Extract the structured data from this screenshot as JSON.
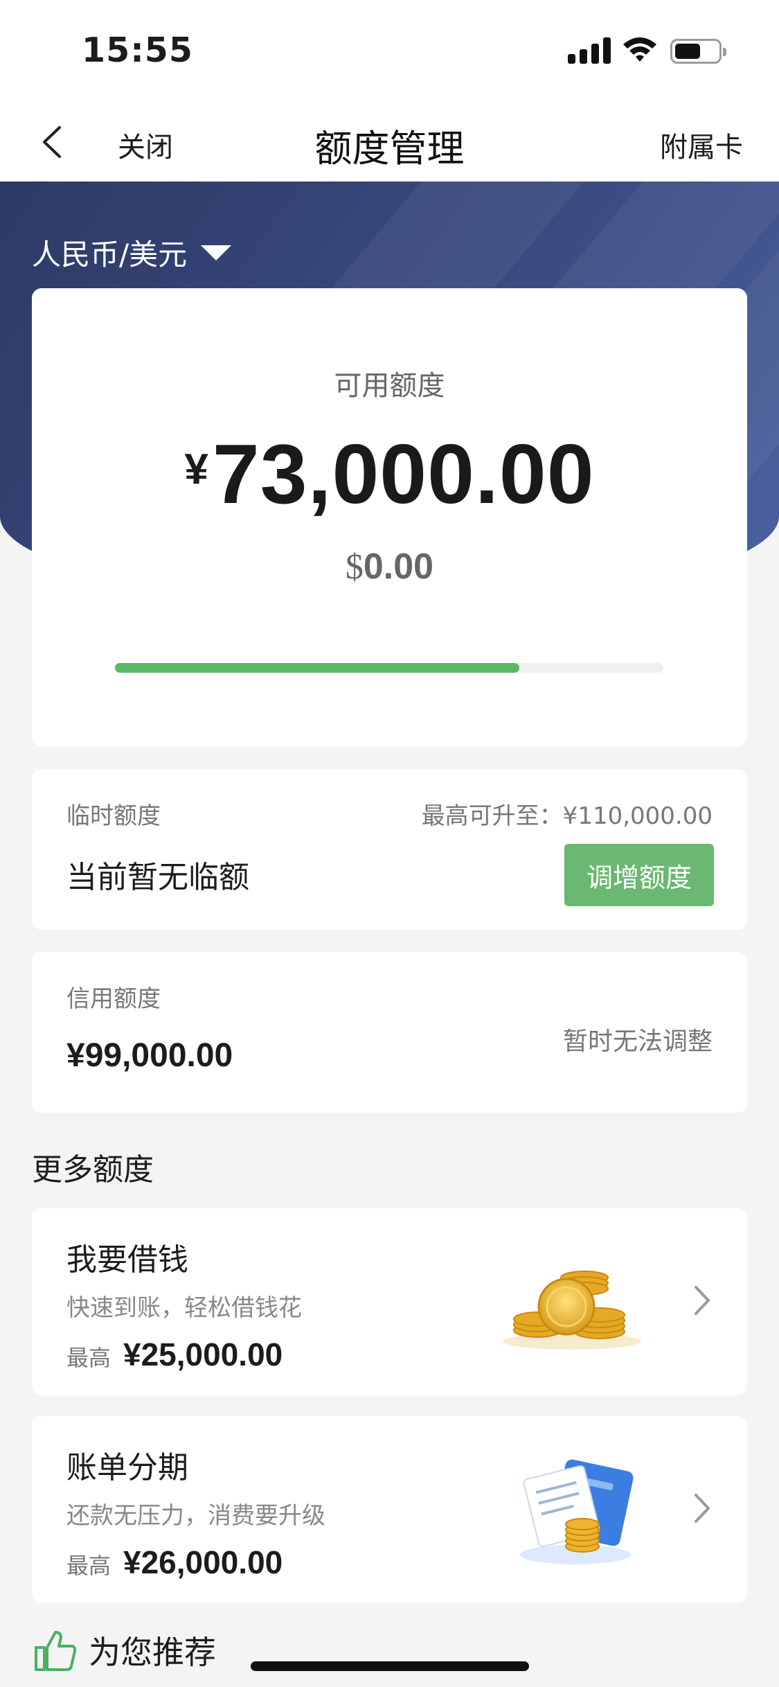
{
  "status_bar": {
    "time": "15:55"
  },
  "nav": {
    "close_label": "关闭",
    "title": "额度管理",
    "right_label": "附属卡"
  },
  "currency_selector": {
    "label": "人民币/美元"
  },
  "available": {
    "label": "可用额度",
    "currency_symbol": "¥",
    "amount": "73,000.00",
    "usd_symbol": "$",
    "usd_amount": "0.00",
    "progress_fraction": 0.737,
    "progress_color": "#5cb867"
  },
  "temporary": {
    "label": "临时额度",
    "max_text": "最高可升至：¥110,000.00",
    "value": "当前暂无临额",
    "button_label": "调增额度"
  },
  "credit": {
    "label": "信用额度",
    "value": "¥99,000.00",
    "status": "暂时无法调整"
  },
  "more": {
    "title": "更多额度",
    "items": [
      {
        "title": "我要借钱",
        "desc": "快速到账，轻松借钱花",
        "max_label": "最高",
        "max_value": "¥25,000.00",
        "icon": "coins-stack-illustration"
      },
      {
        "title": "账单分期",
        "desc": "还款无压力，消费要升级",
        "max_label": "最高",
        "max_value": "¥26,000.00",
        "icon": "bill-card-coins-illustration"
      }
    ]
  },
  "recommend": {
    "label": "为您推荐",
    "icon": "thumbs-up-icon"
  },
  "colors": {
    "brand_navy": "#3a4b80",
    "accent_green": "#6ab871"
  }
}
